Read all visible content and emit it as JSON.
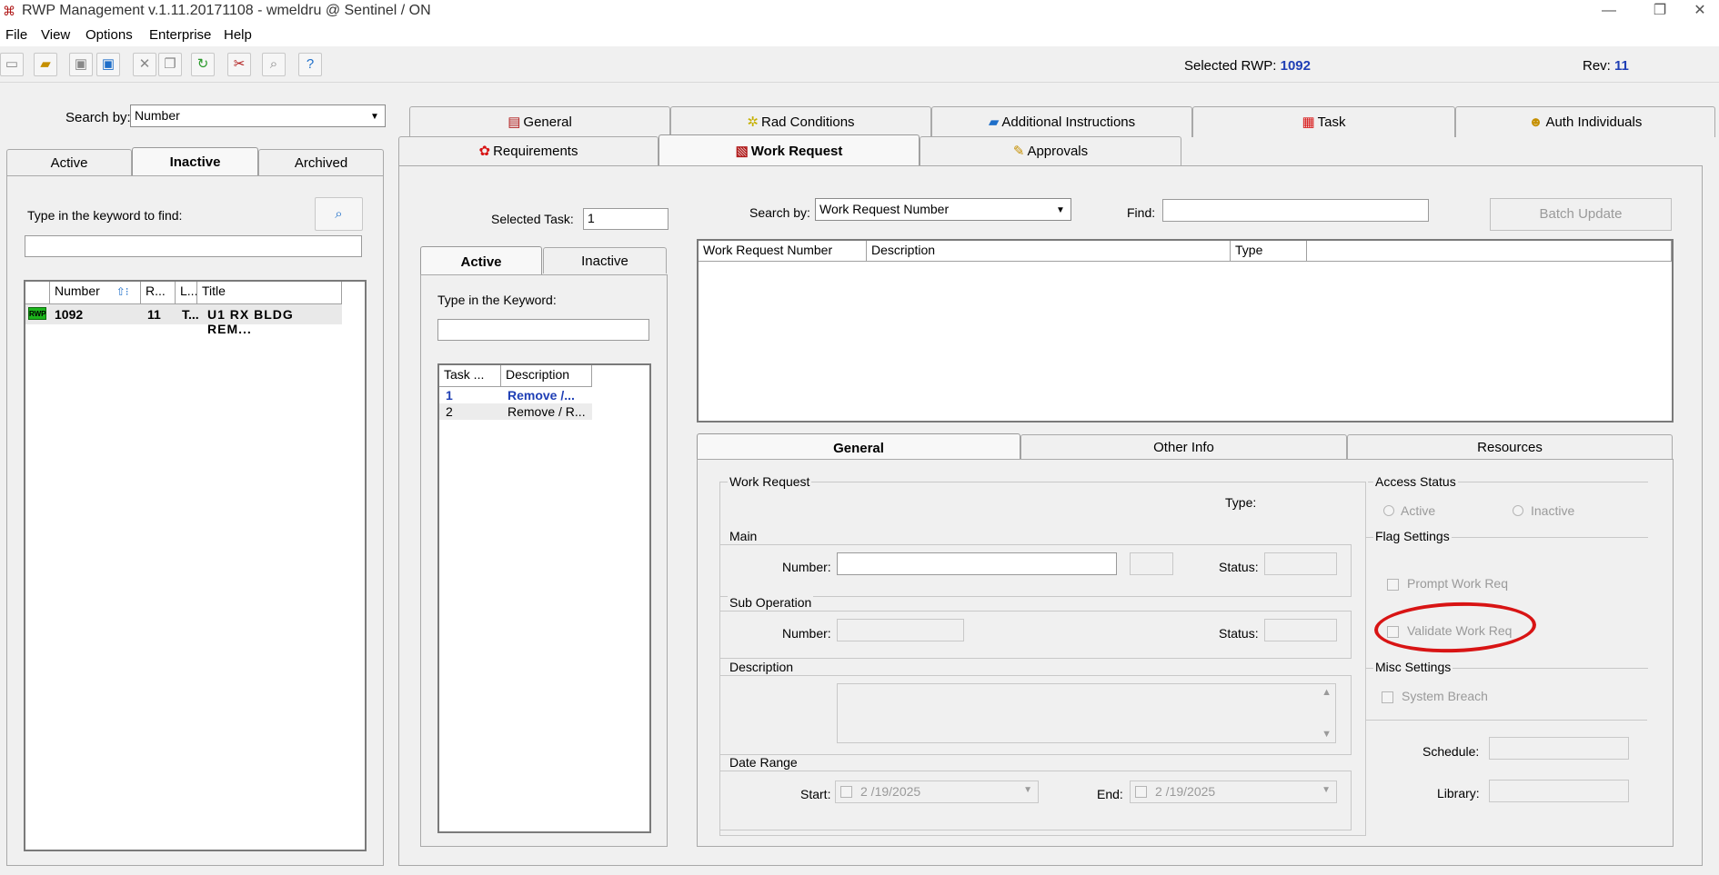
{
  "window": {
    "title": "RWP Management v.1.11.20171108  -  wmeldru @ Sentinel / ON"
  },
  "menu": [
    "File",
    "View",
    "Options",
    "Enterprise",
    "Help"
  ],
  "toolbar_info": {
    "selected_rwp_label": "Selected RWP:",
    "selected_rwp_value": "1092",
    "rev_label": "Rev:",
    "rev_value": "11"
  },
  "left": {
    "search_by_label": "Search by:",
    "search_by_value": "Number",
    "tabs": [
      "Active",
      "Inactive",
      "Archived"
    ],
    "keyword_label": "Type in the keyword to find:",
    "columns": [
      "Number",
      "R...",
      "L...",
      "Title"
    ],
    "rows": [
      {
        "badge": "RWP",
        "number": "1092",
        "rev": "11",
        "l": "T...",
        "title": "U1 RX BLDG REM..."
      }
    ]
  },
  "tabs_row1": [
    "General",
    "Rad Conditions",
    "Additional Instructions",
    "Task",
    "Auth Individuals"
  ],
  "tabs_row2": [
    "Requirements",
    "Work Request",
    "Approvals"
  ],
  "work_request": {
    "selected_task_label": "Selected Task:",
    "selected_task_value": "1",
    "search_by_label": "Search by:",
    "search_by_value": "Work Request Number",
    "find_label": "Find:",
    "batch_update": "Batch Update",
    "task_tabs": [
      "Active",
      "Inactive"
    ],
    "task_keyword_label": "Type in the Keyword:",
    "task_columns": [
      "Task ...",
      "Description"
    ],
    "tasks": [
      {
        "num": "1",
        "desc": "Remove /..."
      },
      {
        "num": "2",
        "desc": "Remove / R..."
      }
    ],
    "wr_columns": [
      "Work Request Number",
      "Description",
      "Type"
    ],
    "sub_tabs": [
      "General",
      "Other Info",
      "Resources"
    ],
    "general": {
      "work_request_group": "Work Request",
      "type_label": "Type:",
      "main_group": "Main",
      "number_label": "Number:",
      "status_label": "Status:",
      "sub_op_group": "Sub Operation",
      "sub_number_label": "Number:",
      "sub_status_label": "Status:",
      "description_group": "Description",
      "date_range_group": "Date Range",
      "start_label": "Start:",
      "start_value": "2 /19/2025",
      "end_label": "End:",
      "end_value": "2 /19/2025",
      "access_status_group": "Access Status",
      "access_active": "Active",
      "access_inactive": "Inactive",
      "flag_group": "Flag Settings",
      "prompt_work_req": "Prompt Work Req",
      "validate_work_req": "Validate Work Req",
      "misc_group": "Misc Settings",
      "system_breach": "System Breach",
      "schedule_label": "Schedule:",
      "library_label": "Library:"
    }
  },
  "colors": {
    "annotation": "#d81414",
    "selected_blue": "#1f3fb5"
  }
}
